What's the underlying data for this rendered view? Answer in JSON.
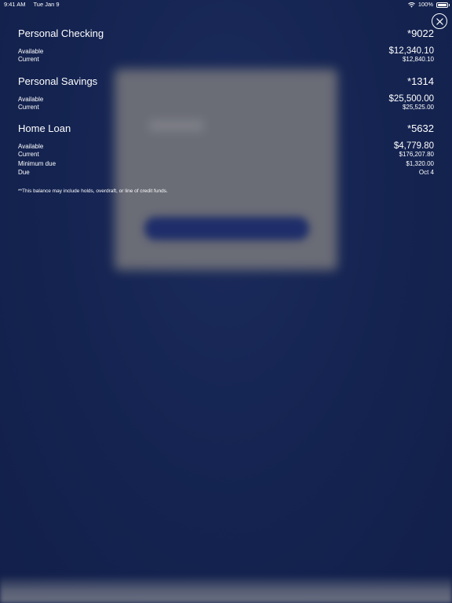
{
  "status_bar": {
    "time": "9:41 AM",
    "date": "Tue Jan 9",
    "battery": "100%"
  },
  "accounts": [
    {
      "name": "Personal Checking",
      "number": "*9022",
      "rows": [
        {
          "label": "Available",
          "value": "$12,340.10",
          "emphasis": true
        },
        {
          "label": "Current",
          "value": "$12,840.10",
          "emphasis": false
        }
      ]
    },
    {
      "name": "Personal Savings",
      "number": "*1314",
      "rows": [
        {
          "label": "Available",
          "value": "$25,500.00",
          "emphasis": true
        },
        {
          "label": "Current",
          "value": "$25,525.00",
          "emphasis": false
        }
      ]
    },
    {
      "name": "Home Loan",
      "number": "*5632",
      "rows": [
        {
          "label": "Available",
          "value": "$4,779.80",
          "emphasis": true
        },
        {
          "label": "Current",
          "value": "$176,207.80",
          "emphasis": false
        },
        {
          "label": "Minimum due",
          "value": "$1,320.00",
          "emphasis": false
        },
        {
          "label": "Due",
          "value": "Oct 4",
          "emphasis": false
        }
      ]
    }
  ],
  "footnote": "**This balance may include holds, overdraft, or line of credit funds.",
  "icons": {
    "close": "close-icon",
    "wifi": "wifi-icon",
    "battery": "battery-icon"
  },
  "colors": {
    "background": "#142350",
    "text": "#ffffff"
  }
}
